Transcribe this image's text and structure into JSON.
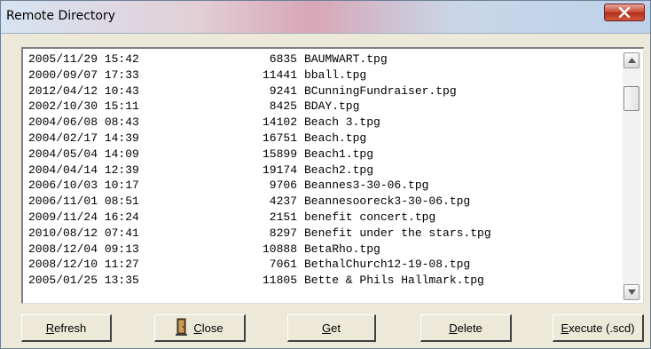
{
  "window": {
    "title": "Remote Directory"
  },
  "files": [
    {
      "date": "2005/11/29 15:42",
      "size": "6835",
      "name": "BAUMWART.tpg"
    },
    {
      "date": "2000/09/07 17:33",
      "size": "11441",
      "name": "bball.tpg"
    },
    {
      "date": "2012/04/12 10:43",
      "size": "9241",
      "name": "BCunningFundraiser.tpg"
    },
    {
      "date": "2002/10/30 15:11",
      "size": "8425",
      "name": "BDAY.tpg"
    },
    {
      "date": "2004/06/08 08:43",
      "size": "14102",
      "name": "Beach 3.tpg"
    },
    {
      "date": "2004/02/17 14:39",
      "size": "16751",
      "name": "Beach.tpg"
    },
    {
      "date": "2004/05/04 14:09",
      "size": "15899",
      "name": "Beach1.tpg"
    },
    {
      "date": "2004/04/14 12:39",
      "size": "19174",
      "name": "Beach2.tpg"
    },
    {
      "date": "2006/10/03 10:17",
      "size": "9706",
      "name": "Beannes3-30-06.tpg"
    },
    {
      "date": "2006/11/01 08:51",
      "size": "4237",
      "name": "Beannesooreck3-30-06.tpg"
    },
    {
      "date": "2009/11/24 16:24",
      "size": "2151",
      "name": "benefit concert.tpg"
    },
    {
      "date": "2010/08/12 07:41",
      "size": "8297",
      "name": "Benefit under the stars.tpg"
    },
    {
      "date": "2008/12/04 09:13",
      "size": "10888",
      "name": "BetaRho.tpg"
    },
    {
      "date": "2008/12/10 11:27",
      "size": "7061",
      "name": "BethalChurch12-19-08.tpg"
    },
    {
      "date": "2005/01/25 13:35",
      "size": "11805",
      "name": "Bette & Phils Hallmark.tpg"
    }
  ],
  "scroll_position_fraction": 0.1,
  "buttons": {
    "refresh": {
      "accel": "R",
      "rest": "efresh"
    },
    "close": {
      "accel": "C",
      "rest": "lose",
      "icon": "door-icon"
    },
    "get": {
      "accel": "G",
      "rest": "et"
    },
    "delete": {
      "accel": "D",
      "rest": "elete"
    },
    "execute": {
      "accel": "E",
      "rest": "xecute (.scd)"
    }
  },
  "colors": {
    "close_button": "#c7452c",
    "dialog_face": "#ece9d8",
    "door_icon": "#6b4f2a"
  }
}
